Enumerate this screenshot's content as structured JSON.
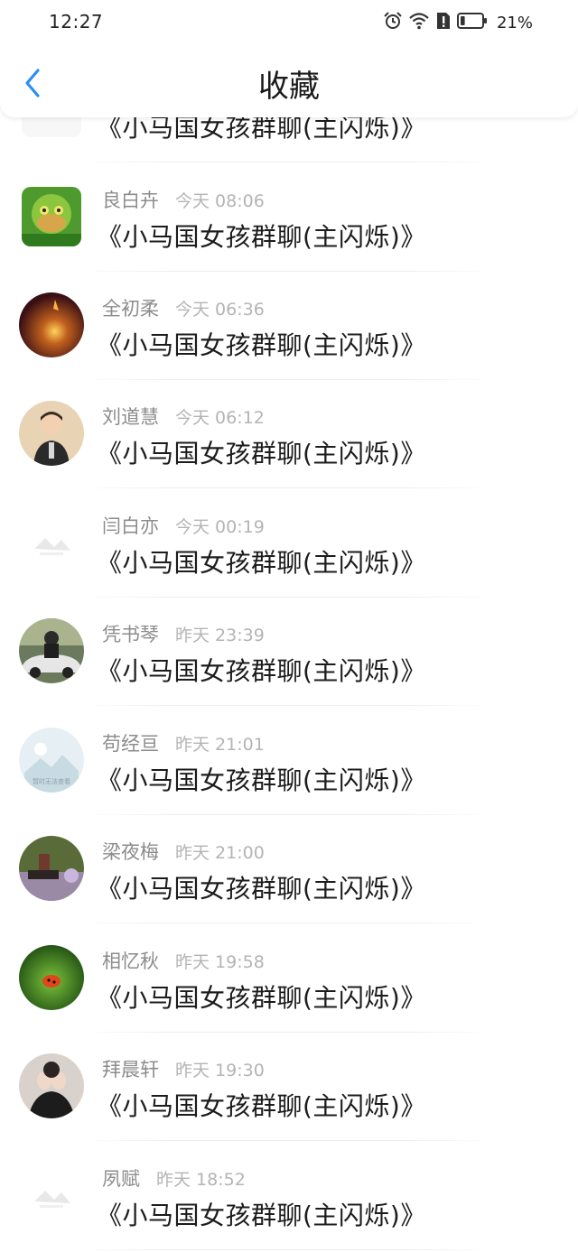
{
  "status_bar": {
    "time": "12:27",
    "battery_percent": "21%",
    "battery_level": 0.21
  },
  "nav": {
    "title": "收藏",
    "back_icon": "chevron-left-icon"
  },
  "colors": {
    "accent": "#2b8ef5",
    "title_text": "#1c1c1c",
    "meta_author": "#8c8c8c",
    "meta_time": "#b4b4b4"
  },
  "items": [
    {
      "author": "",
      "time": "",
      "title": "《小马国女孩群聊(主闪烁)》",
      "avatar": "placeholder-icon"
    },
    {
      "author": "良白卉",
      "time": "今天 08:06",
      "title": "《小马国女孩群聊(主闪烁)》",
      "avatar": "frog-avatar"
    },
    {
      "author": "全初柔",
      "time": "今天 06:36",
      "title": "《小马国女孩群聊(主闪烁)》",
      "avatar": "glow-avatar"
    },
    {
      "author": "刘道慧",
      "time": "今天 06:12",
      "title": "《小马国女孩群聊(主闪烁)》",
      "avatar": "person-avatar"
    },
    {
      "author": "闫白亦",
      "time": "今天 00:19",
      "title": "《小马国女孩群聊(主闪烁)》",
      "avatar": "placeholder-icon"
    },
    {
      "author": "凭书琴",
      "time": "昨天 23:39",
      "title": "《小马国女孩群聊(主闪烁)》",
      "avatar": "car-avatar"
    },
    {
      "author": "苟经亘",
      "time": "昨天 21:01",
      "title": "《小马国女孩群聊(主闪烁)》",
      "avatar": "image-unavailable-avatar",
      "avatar_text": "暂时无法查看"
    },
    {
      "author": "梁夜梅",
      "time": "昨天 21:00",
      "title": "《小马国女孩群聊(主闪烁)》",
      "avatar": "still-life-avatar"
    },
    {
      "author": "相忆秋",
      "time": "昨天 19:58",
      "title": "《小马国女孩群聊(主闪烁)》",
      "avatar": "ladybug-avatar"
    },
    {
      "author": "拜晨轩",
      "time": "昨天 19:30",
      "title": "《小马国女孩群聊(主闪烁)》",
      "avatar": "hands-avatar"
    },
    {
      "author": "夙赋",
      "time": "昨天 18:52",
      "title": "《小马国女孩群聊(主闪烁)》",
      "avatar": "placeholder-icon"
    }
  ]
}
